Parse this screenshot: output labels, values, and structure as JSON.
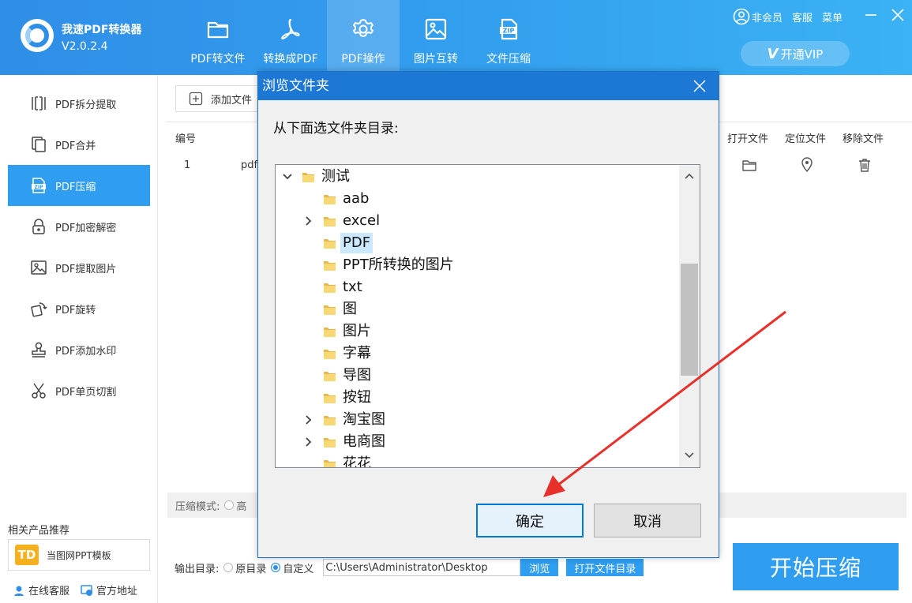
{
  "app": {
    "name": "我速PDF转换器",
    "version": "V2.0.2.4"
  },
  "nav_tabs": [
    {
      "label": "PDF转文件",
      "icon": "folder-icon"
    },
    {
      "label": "转换成PDF",
      "icon": "acrobat-icon"
    },
    {
      "label": "PDF操作",
      "icon": "gear-icon"
    },
    {
      "label": "图片互转",
      "icon": "image-icon"
    },
    {
      "label": "文件压缩",
      "icon": "zip-icon"
    }
  ],
  "active_tab": "PDF操作",
  "user": {
    "member": "非会员",
    "service": "客服",
    "menu": "菜单",
    "vip": "开通VIP",
    "vip_mark": "V"
  },
  "sidebar": {
    "items": [
      {
        "label": "PDF拆分提取",
        "icon": "split-icon"
      },
      {
        "label": "PDF合并",
        "icon": "merge-icon"
      },
      {
        "label": "PDF压缩",
        "icon": "zip-file-icon"
      },
      {
        "label": "PDF加密解密",
        "icon": "lock-icon"
      },
      {
        "label": "PDF提取图片",
        "icon": "extract-image-icon"
      },
      {
        "label": "PDF旋转",
        "icon": "rotate-icon"
      },
      {
        "label": "PDF添加水印",
        "icon": "stamp-icon"
      },
      {
        "label": "PDF单页切割",
        "icon": "scissors-icon"
      }
    ],
    "active": "PDF压缩",
    "related_title": "相关产品推荐",
    "related_product": "当图网PPT模板",
    "related_logo": "TD",
    "links": {
      "online_service": "在线客服",
      "official_site": "官方地址"
    }
  },
  "main": {
    "add_file": "添加文件",
    "columns": {
      "number": "编号",
      "open": "打开文件",
      "locate": "定位文件",
      "remove": "移除文件"
    },
    "rows": [
      {
        "number": "1",
        "name": "pdf"
      }
    ],
    "compress_mode_label": "压缩模式:",
    "compress_mode_first": "高",
    "output_label": "输出目录:",
    "output_original": "原目录",
    "output_custom": "自定义",
    "output_path": "C:\\Users\\Administrator\\Desktop",
    "browse": "浏览",
    "open_dir": "打开文件目录",
    "start": "开始压缩"
  },
  "dialog": {
    "title": "浏览文件夹",
    "prompt": "从下面选文件夹目录:",
    "tree": [
      {
        "name": "测试",
        "level": 0,
        "expander": "expanded"
      },
      {
        "name": "aab",
        "level": 1,
        "expander": "none"
      },
      {
        "name": "excel",
        "level": 1,
        "expander": "collapsed"
      },
      {
        "name": "PDF",
        "level": 1,
        "expander": "none",
        "selected": true
      },
      {
        "name": "PPT所转换的图片",
        "level": 1,
        "expander": "none"
      },
      {
        "name": "txt",
        "level": 1,
        "expander": "none"
      },
      {
        "name": "图",
        "level": 1,
        "expander": "none"
      },
      {
        "name": "图片",
        "level": 1,
        "expander": "none"
      },
      {
        "name": "字幕",
        "level": 1,
        "expander": "none"
      },
      {
        "name": "导图",
        "level": 1,
        "expander": "none"
      },
      {
        "name": "按钮",
        "level": 1,
        "expander": "none"
      },
      {
        "name": "淘宝图",
        "level": 1,
        "expander": "collapsed"
      },
      {
        "name": "电商图",
        "level": 1,
        "expander": "collapsed"
      },
      {
        "name": "花花",
        "level": 1,
        "expander": "none"
      }
    ],
    "ok": "确定",
    "cancel": "取消"
  },
  "colors": {
    "accent": "#2f9df0",
    "titlebar": "#1c78d4",
    "selection": "#cce8ff",
    "annotation": "#e8302a"
  }
}
